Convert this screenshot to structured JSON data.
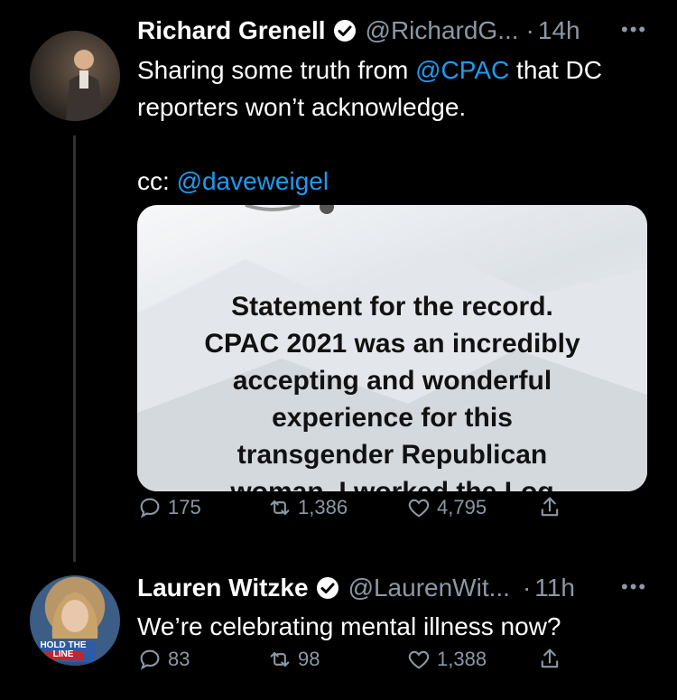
{
  "tweets": [
    {
      "name": "Richard Grenell",
      "handle": "@RichardG...",
      "separator": "·",
      "time": "14h",
      "text_parts": {
        "line1_a": "Sharing some truth from ",
        "line1_mention": "@CPAC",
        "line1_b": " that DC",
        "line2": "reporters won’t acknowledge.",
        "cc_label": "cc: ",
        "cc_mention": "@daveweigel"
      },
      "media_lines": [
        "Statement for the record.",
        "CPAC 2021 was an incredibly",
        "accepting and wonderful",
        "experience for this",
        "transgender Republican",
        "woman. I worked the Log"
      ],
      "replies": "175",
      "retweets": "1,386",
      "likes": "4,795"
    },
    {
      "name": "Lauren Witzke",
      "handle": "@LaurenWit...",
      "separator": "·",
      "time": "11h",
      "text": "We’re celebrating mental illness now?",
      "avatar_badge": "HOLD THE LINE",
      "replies": "83",
      "retweets": "98",
      "likes": "1,388"
    }
  ],
  "colors": {
    "accent": "#1d9bf0",
    "muted": "#8b98a5",
    "background": "#000000"
  }
}
